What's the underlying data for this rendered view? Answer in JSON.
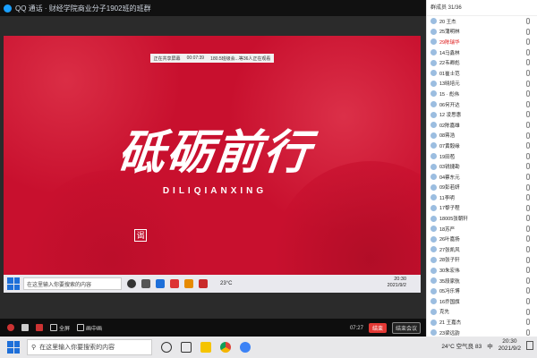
{
  "window": {
    "title": "QQ 通话 · 财经学院商业分子1902班的班群",
    "controls": [
      "—",
      "□",
      "✕"
    ]
  },
  "slide": {
    "info_items": [
      "正在共享屏幕",
      "00:07:39",
      "180.5班级会...等36人正在观看"
    ],
    "title": "砥砺前行",
    "pinyin": "DILIQIANXING",
    "seal_char": "谒"
  },
  "inner_taskbar": {
    "search_placeholder": "在这里输入你要搜索的内容",
    "weather": "23°C",
    "time": "20:30",
    "date": "2021/9/2"
  },
  "controlbar": {
    "left_items": [
      "",
      "",
      "",
      "全屏",
      "画中画"
    ],
    "timer": "07:27",
    "end_label": "结束",
    "end_meeting_label": "结束会议"
  },
  "panel": {
    "header": "群成员 31/36",
    "members": [
      {
        "name": "20 王杰"
      },
      {
        "name": "25蒲明林"
      },
      {
        "name": "29陈瑞华",
        "highlight": true
      },
      {
        "name": "14马鑫林"
      },
      {
        "name": "22韦卿彪"
      },
      {
        "name": "01崔士范"
      },
      {
        "name": "13晓培元"
      },
      {
        "name": "15 · 彪伟"
      },
      {
        "name": "06何开达"
      },
      {
        "name": "12 凌思惠"
      },
      {
        "name": "02陈嘉雄"
      },
      {
        "name": "08蒋浩"
      },
      {
        "name": "07黄毅缘"
      },
      {
        "name": "19田苞"
      },
      {
        "name": "03锐捷勘"
      },
      {
        "name": "04蔡东元"
      },
      {
        "name": "09彭若妍"
      },
      {
        "name": "11李明"
      },
      {
        "name": "17黎子程"
      },
      {
        "name": "18005张朝轩"
      },
      {
        "name": "18苏严"
      },
      {
        "name": "26叶嘉扬"
      },
      {
        "name": "27张凯风"
      },
      {
        "name": "28张子轩"
      },
      {
        "name": "30朱宏伟"
      },
      {
        "name": "35段家航"
      },
      {
        "name": "05冯乐博"
      },
      {
        "name": "16乔国旗"
      },
      {
        "name": "克先"
      },
      {
        "name": "21 王嘉杰"
      },
      {
        "name": "23梁远韵"
      }
    ]
  },
  "taskbar": {
    "search_placeholder": "在这里输入你要搜索的内容",
    "weather": "24°C 空气良 83",
    "ime": "中",
    "time": "20:30",
    "date": "2021/9/2"
  },
  "colors": {
    "slide_red": "#c8102e",
    "accent_blue": "#1e6fd9",
    "end_red": "#e53935"
  }
}
